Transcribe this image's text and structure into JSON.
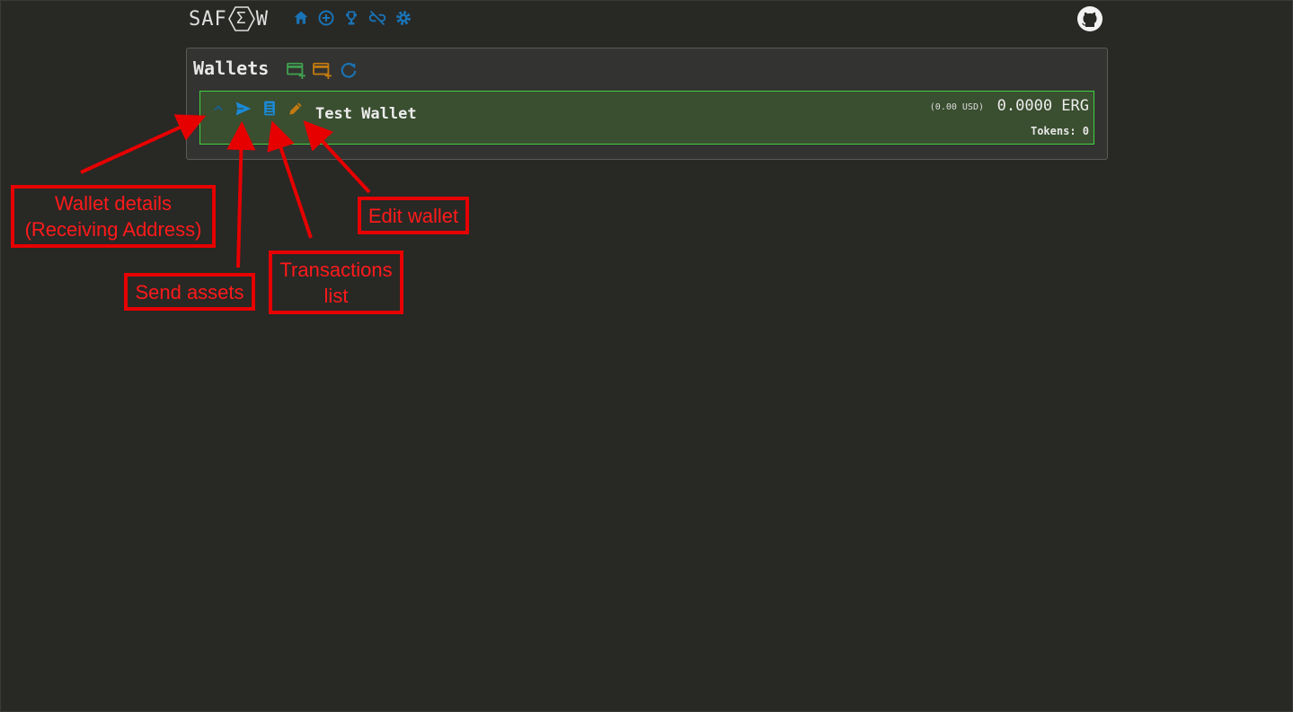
{
  "nav": {
    "logo_left": "SAF",
    "logo_symbol": "Σ",
    "logo_right": "W",
    "icons": [
      "home-icon",
      "add-circle-icon",
      "trophy-icon",
      "link-off-icon",
      "gear-icon",
      "github-icon"
    ]
  },
  "wallets_panel": {
    "title": "Wallets",
    "tools": [
      "add-wallet-icon",
      "add-readonly-wallet-icon",
      "refresh-icon"
    ]
  },
  "wallet": {
    "name": "Test Wallet",
    "usd_value": "(0.00 USD)",
    "amount": "0.0000 ERG",
    "tokens": "Tokens: 0",
    "icons": [
      "chevron-up-icon",
      "send-icon",
      "transactions-icon",
      "edit-icon"
    ],
    "border_color": "#3fd23f",
    "background_color": "#3a4e30"
  },
  "annotations": [
    {
      "text_line1": "Wallet details",
      "text_line2": "(Receiving Address)"
    },
    {
      "text_line1": "Send assets"
    },
    {
      "text_line1": "Transactions",
      "text_line2": "list"
    },
    {
      "text_line1": "Edit wallet"
    }
  ],
  "colors": {
    "background": "#282825",
    "accent_blue": "#1a73b5",
    "green": "#3f9f4f",
    "orange": "#c27a10",
    "annotation_red": "#e60000"
  }
}
